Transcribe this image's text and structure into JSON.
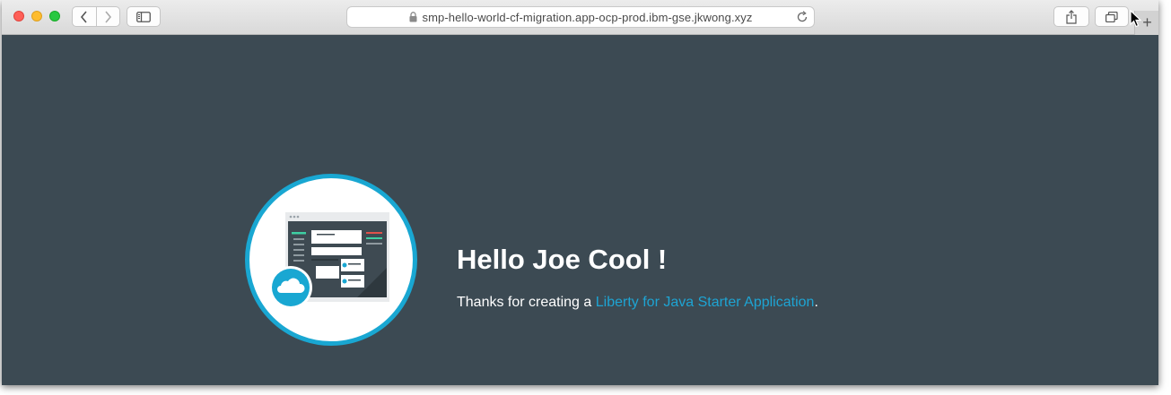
{
  "browser": {
    "url": "smp-hello-world-cf-migration.app-ocp-prod.ibm-gse.jkwong.xyz",
    "new_tab_label": "+"
  },
  "page": {
    "greeting": "Hello Joe Cool !",
    "message_prefix": "Thanks for creating a ",
    "link_text": "Liberty for Java Starter Application",
    "message_suffix": ".",
    "colors": {
      "background": "#3c4a53",
      "accent": "#19a7d2",
      "link": "#1ea4d3"
    }
  }
}
